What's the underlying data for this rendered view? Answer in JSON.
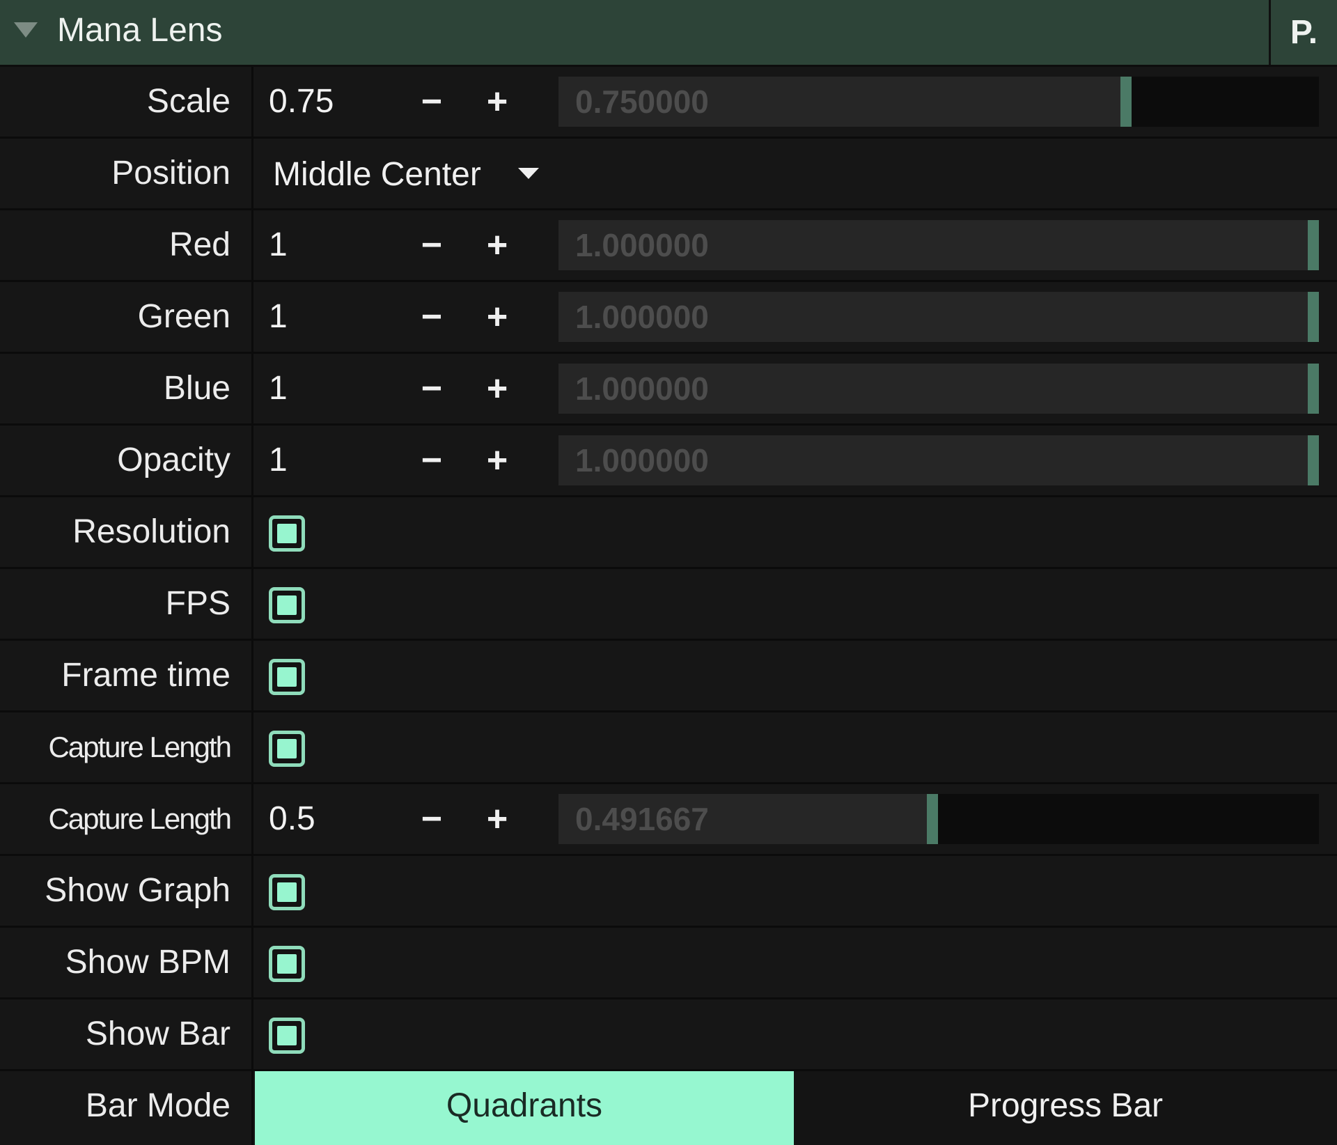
{
  "header": {
    "title": "Mana Lens",
    "right_button": "P."
  },
  "colors": {
    "header_bg": "#2d4438",
    "accent": "#96f7d0",
    "slider_grab": "#4b7a66"
  },
  "rows": {
    "scale": {
      "label": "Scale",
      "value": "0.75",
      "minus": "−",
      "plus": "+",
      "slider_text": "0.750000",
      "slider_fraction": 0.75
    },
    "position": {
      "label": "Position",
      "value": "Middle Center"
    },
    "red": {
      "label": "Red",
      "value": "1",
      "minus": "−",
      "plus": "+",
      "slider_text": "1.000000",
      "slider_fraction": 1.0
    },
    "green": {
      "label": "Green",
      "value": "1",
      "minus": "−",
      "plus": "+",
      "slider_text": "1.000000",
      "slider_fraction": 1.0
    },
    "blue": {
      "label": "Blue",
      "value": "1",
      "minus": "−",
      "plus": "+",
      "slider_text": "1.000000",
      "slider_fraction": 1.0
    },
    "opacity": {
      "label": "Opacity",
      "value": "1",
      "minus": "−",
      "plus": "+",
      "slider_text": "1.000000",
      "slider_fraction": 1.0
    },
    "resolution": {
      "label": "Resolution",
      "checked": true
    },
    "fps": {
      "label": "FPS",
      "checked": true
    },
    "frame_time": {
      "label": "Frame time",
      "checked": true
    },
    "capture_length_toggle": {
      "label": "Capture Length",
      "checked": true
    },
    "capture_length": {
      "label": "Capture Length",
      "value": "0.5",
      "minus": "−",
      "plus": "+",
      "slider_text": "0.491667",
      "slider_fraction": 0.491667
    },
    "show_graph": {
      "label": "Show Graph",
      "checked": true
    },
    "show_bpm": {
      "label": "Show BPM",
      "checked": true
    },
    "show_bar": {
      "label": "Show Bar",
      "checked": true
    },
    "bar_mode": {
      "label": "Bar Mode",
      "options": [
        "Quadrants",
        "Progress Bar"
      ],
      "selected": "Quadrants"
    }
  }
}
